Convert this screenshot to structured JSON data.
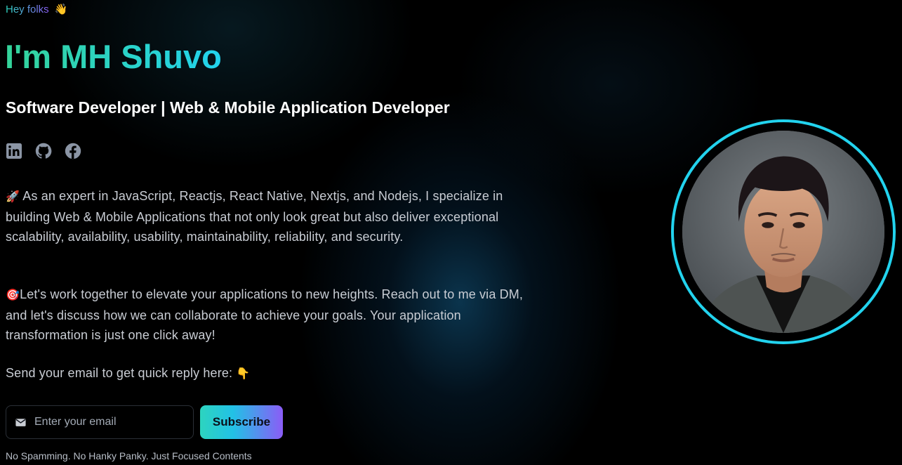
{
  "hero": {
    "greeting": "Hey folks",
    "greeting_emoji": "👋",
    "name": "I'm MH Shuvo",
    "role": "Software Developer | Web & Mobile Application Developer"
  },
  "socials": [
    {
      "icon": "linkedin-icon",
      "color": "#8b95a5"
    },
    {
      "icon": "github-icon",
      "color": "#8b95a5"
    },
    {
      "icon": "facebook-icon",
      "color": "#8b95a5"
    }
  ],
  "intro": {
    "p1_emoji": "🚀",
    "p1": "As an expert in JavaScript, Reactjs, React Native, Nextjs, and Nodejs, I specialize in building Web & Mobile Applications that not only look great but also deliver exceptional scalability, availability, usability, maintainability, reliability, and security.",
    "p2_emoji": "🎯",
    "p2": "Let's work together to elevate your applications to new heights. Reach out to me via DM, and let's discuss how we can collaborate to achieve your goals. Your application transformation is just one click away!",
    "p3": "Send your email to get quick reply here:",
    "p3_emoji": "👇"
  },
  "subscribe": {
    "placeholder": "Enter your email",
    "value": "",
    "button_label": "Subscribe",
    "note": "No Spamming. No Hanky Panky. Just Focused Contents"
  },
  "colors": {
    "accent_cyan": "#22d3ee",
    "accent_green": "#34d399",
    "accent_purple": "#8b5cf6",
    "background": "#000000"
  }
}
